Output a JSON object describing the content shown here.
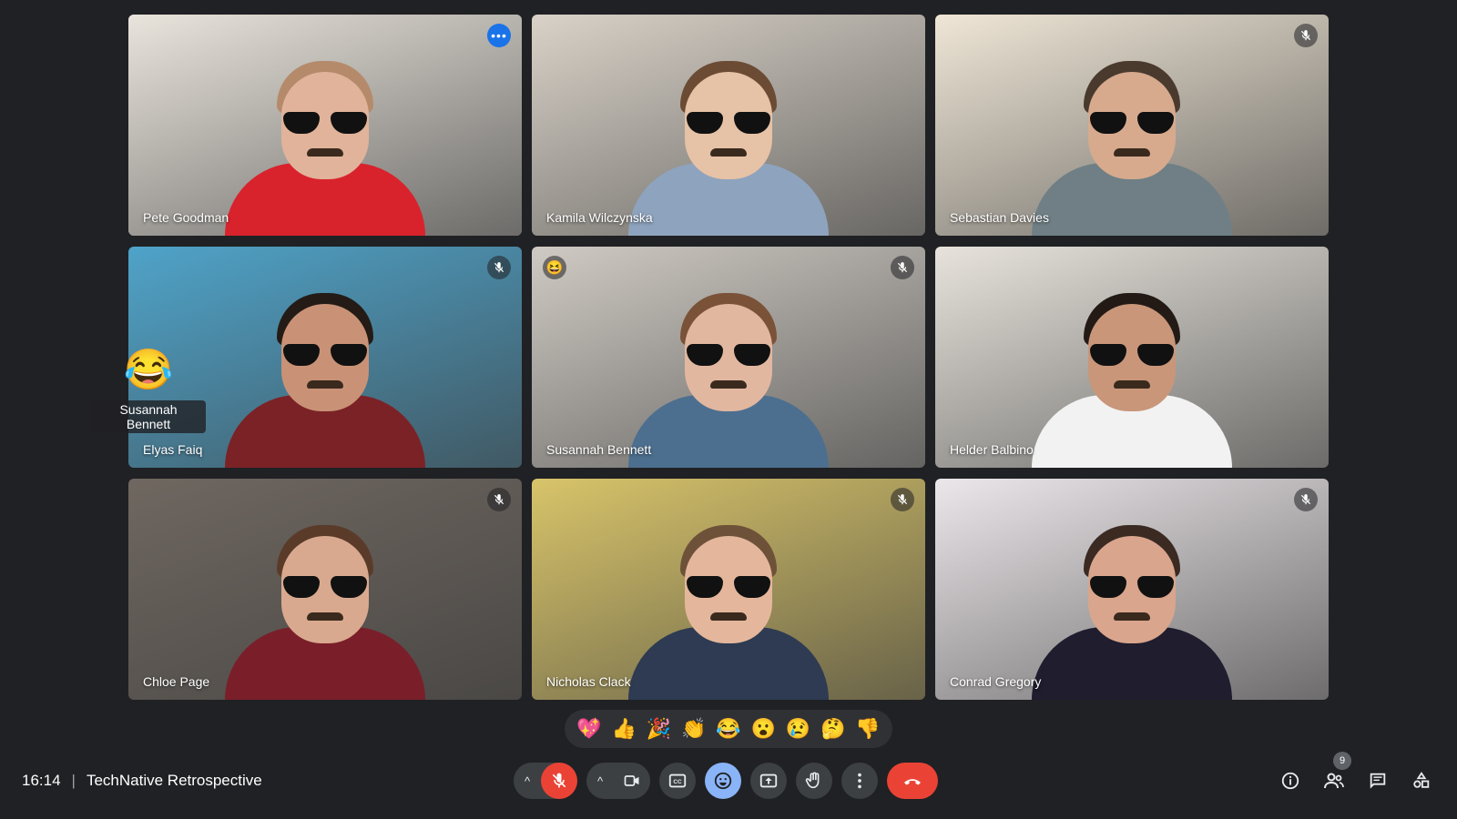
{
  "participants": [
    {
      "name": "Pete Goodman",
      "bg": "#e9e4dc",
      "skin": "#e0b39a",
      "hair": "#b58a6b",
      "shirt": "#d8232d",
      "active": true
    },
    {
      "name": "Kamila Wilczynska",
      "bg": "#d9d2c8",
      "skin": "#e6c2a6",
      "hair": "#6b4b33",
      "shirt": "#8ea3bd",
      "muted": false
    },
    {
      "name": "Sebastian Davies",
      "bg": "#efe6d6",
      "skin": "#d7aa8e",
      "hair": "#4a3a2e",
      "shirt": "#6f7f85",
      "muted": true
    },
    {
      "name": "Elyas Faiq",
      "bg": "#4fa3c9",
      "skin": "#c99276",
      "hair": "#241b16",
      "shirt": "#7b2226",
      "muted": true
    },
    {
      "name": "Susannah Bennett",
      "bg": "#cfcac3",
      "skin": "#e2b7a0",
      "hair": "#7a5238",
      "shirt": "#4d6f8f",
      "muted": true,
      "emoji": "😆"
    },
    {
      "name": "Helder Balbino",
      "bg": "#e7e3dc",
      "skin": "#c9967a",
      "hair": "#231a16",
      "shirt": "#f2f2f2",
      "muted": false
    },
    {
      "name": "Chloe Page",
      "bg": "#6f6760",
      "skin": "#d9a98f",
      "hair": "#5a3b2a",
      "shirt": "#7a1f2a",
      "muted": true
    },
    {
      "name": "Nicholas Clack",
      "bg": "#d8c46a",
      "skin": "#e4b79c",
      "hair": "#6d5139",
      "shirt": "#2e3b52",
      "muted": true
    },
    {
      "name": "Conrad Gregory",
      "bg": "#ece7ea",
      "skin": "#d9a58c",
      "hair": "#3a2a22",
      "shirt": "#1f1d2e",
      "muted": true
    }
  ],
  "floating_reaction": {
    "emoji": "😂",
    "name": "Susannah Bennett"
  },
  "reactions": [
    "💖",
    "👍",
    "🎉",
    "👏",
    "😂",
    "😮",
    "😢",
    "🤔",
    "👎"
  ],
  "meeting": {
    "time": "16:14",
    "separator": "|",
    "title": "TechNative Retrospective"
  },
  "icons": {
    "more": "•••",
    "caret": "^",
    "mic_off": "🎙",
    "camera": "📹",
    "captions": "CC",
    "emoji": "😊",
    "present": "⇧",
    "hand": "✋",
    "more_vert": "⋮",
    "end_call": "☎",
    "info": "ⓘ",
    "people": "👥",
    "chat": "💬",
    "activities": "⬡"
  },
  "people_count": "9"
}
